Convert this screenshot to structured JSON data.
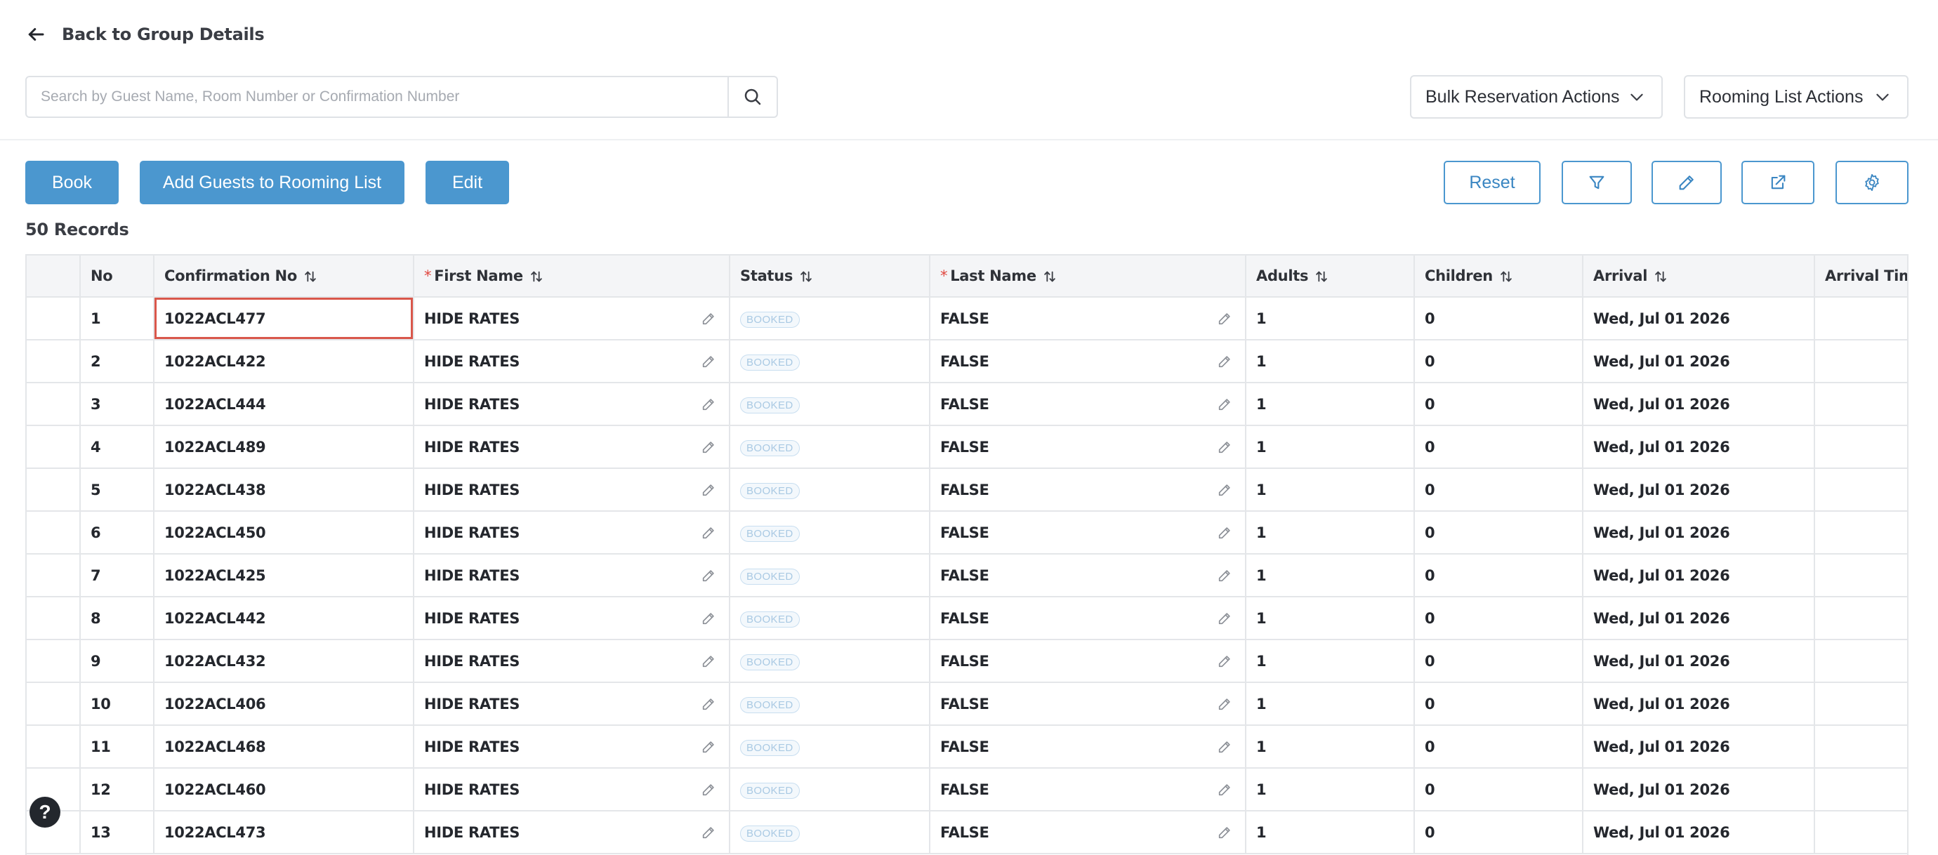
{
  "nav": {
    "back_label": "Back to Group Details"
  },
  "search": {
    "placeholder": "Search by Guest Name, Room Number or Confirmation Number",
    "value": ""
  },
  "dropdowns": {
    "bulk_label": "Bulk Reservation Actions",
    "rooming_label": "Rooming List Actions"
  },
  "toolbar": {
    "book_label": "Book",
    "add_guests_label": "Add Guests to Rooming List",
    "edit_label": "Edit",
    "reset_label": "Reset"
  },
  "records_label": "50 Records",
  "table": {
    "columns": {
      "no": "No",
      "confirmation": "Confirmation No",
      "first_name": "First Name",
      "status": "Status",
      "last_name": "Last Name",
      "adults": "Adults",
      "children": "Children",
      "arrival": "Arrival",
      "arrival_time": "Arrival Time"
    },
    "rows": [
      {
        "no": "1",
        "confirmation": "1022ACL477",
        "first_name": "HIDE RATES",
        "status": "BOOKED",
        "last_name": "FALSE",
        "adults": "1",
        "children": "0",
        "arrival": "Wed, Jul 01 2026"
      },
      {
        "no": "2",
        "confirmation": "1022ACL422",
        "first_name": "HIDE RATES",
        "status": "BOOKED",
        "last_name": "FALSE",
        "adults": "1",
        "children": "0",
        "arrival": "Wed, Jul 01 2026"
      },
      {
        "no": "3",
        "confirmation": "1022ACL444",
        "first_name": "HIDE RATES",
        "status": "BOOKED",
        "last_name": "FALSE",
        "adults": "1",
        "children": "0",
        "arrival": "Wed, Jul 01 2026"
      },
      {
        "no": "4",
        "confirmation": "1022ACL489",
        "first_name": "HIDE RATES",
        "status": "BOOKED",
        "last_name": "FALSE",
        "adults": "1",
        "children": "0",
        "arrival": "Wed, Jul 01 2026"
      },
      {
        "no": "5",
        "confirmation": "1022ACL438",
        "first_name": "HIDE RATES",
        "status": "BOOKED",
        "last_name": "FALSE",
        "adults": "1",
        "children": "0",
        "arrival": "Wed, Jul 01 2026"
      },
      {
        "no": "6",
        "confirmation": "1022ACL450",
        "first_name": "HIDE RATES",
        "status": "BOOKED",
        "last_name": "FALSE",
        "adults": "1",
        "children": "0",
        "arrival": "Wed, Jul 01 2026"
      },
      {
        "no": "7",
        "confirmation": "1022ACL425",
        "first_name": "HIDE RATES",
        "status": "BOOKED",
        "last_name": "FALSE",
        "adults": "1",
        "children": "0",
        "arrival": "Wed, Jul 01 2026"
      },
      {
        "no": "8",
        "confirmation": "1022ACL442",
        "first_name": "HIDE RATES",
        "status": "BOOKED",
        "last_name": "FALSE",
        "adults": "1",
        "children": "0",
        "arrival": "Wed, Jul 01 2026"
      },
      {
        "no": "9",
        "confirmation": "1022ACL432",
        "first_name": "HIDE RATES",
        "status": "BOOKED",
        "last_name": "FALSE",
        "adults": "1",
        "children": "0",
        "arrival": "Wed, Jul 01 2026"
      },
      {
        "no": "10",
        "confirmation": "1022ACL406",
        "first_name": "HIDE RATES",
        "status": "BOOKED",
        "last_name": "FALSE",
        "adults": "1",
        "children": "0",
        "arrival": "Wed, Jul 01 2026"
      },
      {
        "no": "11",
        "confirmation": "1022ACL468",
        "first_name": "HIDE RATES",
        "status": "BOOKED",
        "last_name": "FALSE",
        "adults": "1",
        "children": "0",
        "arrival": "Wed, Jul 01 2026"
      },
      {
        "no": "12",
        "confirmation": "1022ACL460",
        "first_name": "HIDE RATES",
        "status": "BOOKED",
        "last_name": "FALSE",
        "adults": "1",
        "children": "0",
        "arrival": "Wed, Jul 01 2026"
      },
      {
        "no": "13",
        "confirmation": "1022ACL473",
        "first_name": "HIDE RATES",
        "status": "BOOKED",
        "last_name": "FALSE",
        "adults": "1",
        "children": "0",
        "arrival": "Wed, Jul 01 2026"
      }
    ]
  },
  "help_label": "?"
}
